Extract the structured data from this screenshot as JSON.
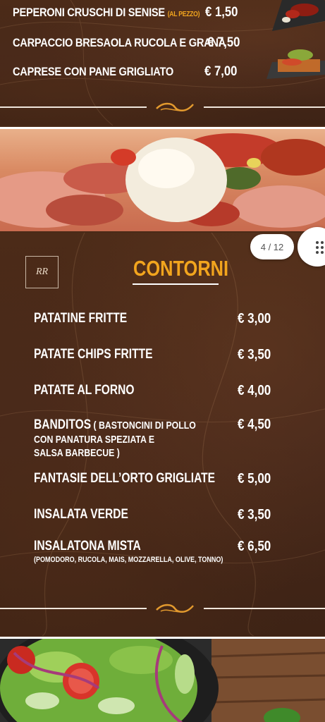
{
  "top_items": [
    {
      "name": "PEPERONI CRUSCHI DI SENISE",
      "note": "(AL PEZZO)",
      "price": "€ 1,50"
    },
    {
      "name": "CARPACCIO BRESAOLA RUCOLA E GRANA",
      "note": "",
      "price": "€ 7,50"
    },
    {
      "name": "CAPRESE CON PANE GRIGLIATO",
      "note": "",
      "price": "€ 7,00"
    }
  ],
  "pager": {
    "label": "4 / 12"
  },
  "logo": {
    "text": "RR"
  },
  "section": {
    "title": "CONTORNI",
    "items": [
      {
        "name": "PATATINE FRITTE",
        "price": "€ 3,00"
      },
      {
        "name": "PATATE CHIPS FRITTE",
        "price": "€ 3,50"
      },
      {
        "name": "PATATE AL FORNO",
        "price": "€ 4,00"
      },
      {
        "name_line1": "BANDITOS",
        "name_line1_desc": " ( BASTONCINI DI POLLO",
        "name_line2": "CON PANATURA SPEZIATA E",
        "name_line3": "SALSA BARBECUE )",
        "price": "€ 4,50"
      },
      {
        "name": "FANTASIE DELL’ORTO GRIGLIATE",
        "price": "€ 5,00"
      },
      {
        "name": "INSALATA VERDE",
        "price": "€ 3,50"
      },
      {
        "name": "INSALATONA MISTA",
        "sub": "(POMODORO, RUCOLA, MAIS, MOZZARELLA, OLIVE, TONNO)",
        "price": "€ 6,50"
      }
    ]
  },
  "colors": {
    "background": "#4a2a17",
    "accent": "#f2a51e",
    "text": "#ffffff"
  }
}
